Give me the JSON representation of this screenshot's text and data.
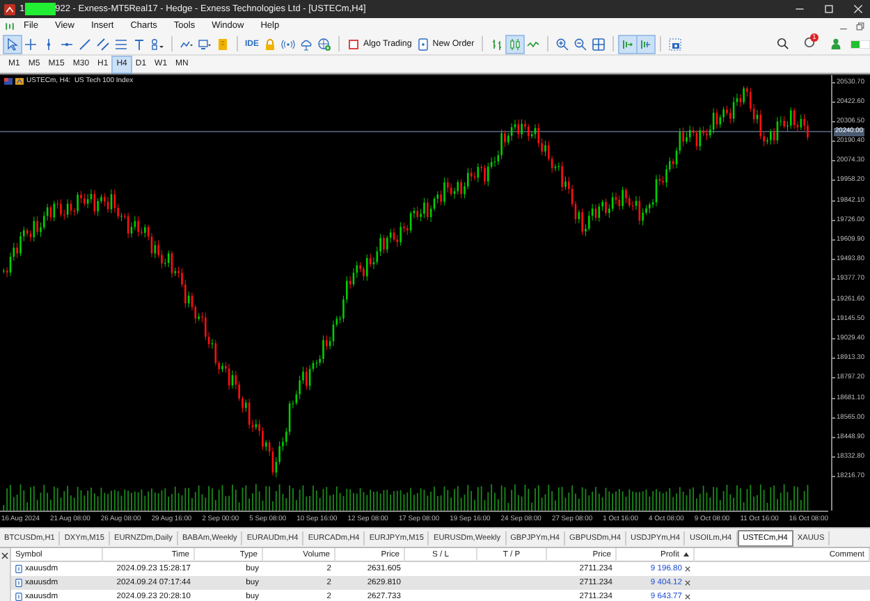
{
  "window": {
    "title_prefix": "1",
    "title": "922 - Exness-MT5Real17 - Hedge - Exness Technologies Ltd - [USTECm,H4]"
  },
  "menu": [
    "File",
    "View",
    "Insert",
    "Charts",
    "Tools",
    "Window",
    "Help"
  ],
  "toolbar": {
    "tools": [
      {
        "selected": true
      },
      {
        "selected": false
      },
      {
        "selected": false
      },
      {
        "selected": false
      },
      {
        "selected": false
      },
      {
        "selected": false
      },
      {
        "selected": false
      },
      {
        "selected": false
      },
      {
        "selected": false
      },
      {
        "selected": false
      },
      {
        "selected": false
      },
      {
        "selected": false
      },
      {
        "selected": false
      },
      {
        "selected": false
      },
      {
        "selected": false
      },
      {
        "selected": false
      },
      {
        "selected": false
      },
      {
        "selected": false
      },
      {
        "selected": false
      },
      {
        "selected": false
      },
      {
        "selected": true
      },
      {
        "selected": false
      },
      {
        "selected": false
      },
      {
        "selected": false
      },
      {
        "selected": false
      },
      {
        "selected": true
      },
      {
        "selected": true
      },
      {
        "selected": false
      }
    ],
    "ide_label": "IDE",
    "algo_trading": "Algo Trading",
    "new_order": "New Order",
    "notification_count": "1"
  },
  "timeframes": [
    {
      "label": "M1",
      "selected": false
    },
    {
      "label": "M5",
      "selected": false
    },
    {
      "label": "M15",
      "selected": false
    },
    {
      "label": "M30",
      "selected": false
    },
    {
      "label": "H1",
      "selected": false
    },
    {
      "label": "H4",
      "selected": true
    },
    {
      "label": "D1",
      "selected": false
    },
    {
      "label": "W1",
      "selected": false
    },
    {
      "label": "MN",
      "selected": false
    }
  ],
  "chart": {
    "header": "USTECm, H4:  US Tech 100 Index",
    "price_labels": [
      "20530.70",
      "20422.60",
      "20306.50",
      "20190.40",
      "20074.30",
      "19958.20",
      "19842.10",
      "19726.00",
      "19609.90",
      "19493.80",
      "19377.70",
      "19261.60",
      "19145.50",
      "19029.40",
      "18913.30",
      "18797.20",
      "18681.10",
      "18565.00",
      "18448.90",
      "18332.80",
      "18216.70"
    ],
    "current_price": "20240.00",
    "time_labels": [
      "16 Aug 2024",
      "21 Aug 08:00",
      "26 Aug 08:00",
      "29 Aug 16:00",
      "2 Sep 00:00",
      "5 Sep 08:00",
      "10 Sep 16:00",
      "12 Sep 08:00",
      "17 Sep 08:00",
      "19 Sep 16:00",
      "24 Sep 08:00",
      "27 Sep 08:00",
      "1 Oct 16:00",
      "4 Oct 08:00",
      "9 Oct 08:00",
      "11 Oct 16:00",
      "16 Oct 08:00"
    ]
  },
  "chart_tabs": [
    {
      "label": "BTCUSDm,H1",
      "selected": false
    },
    {
      "label": "DXYm,M15",
      "selected": false
    },
    {
      "label": "EURNZDm,Daily",
      "selected": false
    },
    {
      "label": "BABAm,Weekly",
      "selected": false
    },
    {
      "label": "EURAUDm,H4",
      "selected": false
    },
    {
      "label": "EURCADm,H4",
      "selected": false
    },
    {
      "label": "EURJPYm,M15",
      "selected": false
    },
    {
      "label": "EURUSDm,Weekly",
      "selected": false
    },
    {
      "label": "GBPJPYm,H4",
      "selected": false
    },
    {
      "label": "GBPUSDm,H4",
      "selected": false
    },
    {
      "label": "USDJPYm,H4",
      "selected": false
    },
    {
      "label": "USOILm,H4",
      "selected": false
    },
    {
      "label": "USTECm,H4",
      "selected": true
    },
    {
      "label": "XAUUS",
      "selected": false
    }
  ],
  "positions": {
    "columns": [
      {
        "label": "Symbol",
        "sorted": false
      },
      {
        "label": "Time",
        "sorted": false
      },
      {
        "label": "Type",
        "sorted": false
      },
      {
        "label": "Volume",
        "sorted": false
      },
      {
        "label": "Price",
        "sorted": false
      },
      {
        "label": "S / L",
        "sorted": false
      },
      {
        "label": "T / P",
        "sorted": false
      },
      {
        "label": "Price",
        "sorted": false
      },
      {
        "label": "Profit",
        "sorted": true
      },
      {
        "label": "Comment",
        "sorted": false
      }
    ],
    "rows": [
      {
        "symbol": "xauusdm",
        "time": "2024.09.23 15:28:17",
        "type": "buy",
        "volume": "2",
        "price": "2631.605",
        "current_price": "2711.234",
        "profit": "9 196.80",
        "selected": false
      },
      {
        "symbol": "xauusdm",
        "time": "2024.09.24 07:17:44",
        "type": "buy",
        "volume": "2",
        "price": "2629.810",
        "current_price": "2711.234",
        "profit": "9 404.12",
        "selected": true
      },
      {
        "symbol": "xauusdm",
        "time": "2024.09.23 20:28:10",
        "type": "buy",
        "volume": "2",
        "price": "2627.733",
        "current_price": "2711.234",
        "profit": "9 643.77",
        "selected": false
      }
    ]
  }
}
